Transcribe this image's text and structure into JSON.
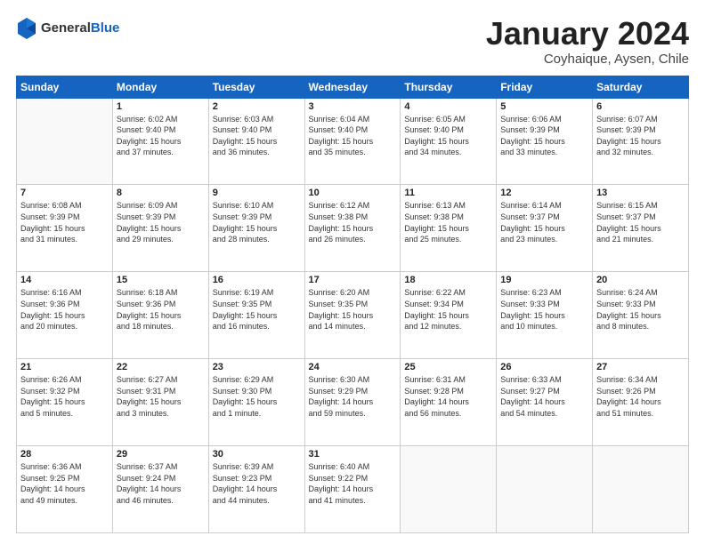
{
  "logo": {
    "general": "General",
    "blue": "Blue"
  },
  "header": {
    "title": "January 2024",
    "location": "Coyhaique, Aysen, Chile"
  },
  "weekdays": [
    "Sunday",
    "Monday",
    "Tuesday",
    "Wednesday",
    "Thursday",
    "Friday",
    "Saturday"
  ],
  "weeks": [
    [
      {
        "day": "",
        "info": ""
      },
      {
        "day": "1",
        "info": "Sunrise: 6:02 AM\nSunset: 9:40 PM\nDaylight: 15 hours\nand 37 minutes."
      },
      {
        "day": "2",
        "info": "Sunrise: 6:03 AM\nSunset: 9:40 PM\nDaylight: 15 hours\nand 36 minutes."
      },
      {
        "day": "3",
        "info": "Sunrise: 6:04 AM\nSunset: 9:40 PM\nDaylight: 15 hours\nand 35 minutes."
      },
      {
        "day": "4",
        "info": "Sunrise: 6:05 AM\nSunset: 9:40 PM\nDaylight: 15 hours\nand 34 minutes."
      },
      {
        "day": "5",
        "info": "Sunrise: 6:06 AM\nSunset: 9:39 PM\nDaylight: 15 hours\nand 33 minutes."
      },
      {
        "day": "6",
        "info": "Sunrise: 6:07 AM\nSunset: 9:39 PM\nDaylight: 15 hours\nand 32 minutes."
      }
    ],
    [
      {
        "day": "7",
        "info": "Sunrise: 6:08 AM\nSunset: 9:39 PM\nDaylight: 15 hours\nand 31 minutes."
      },
      {
        "day": "8",
        "info": "Sunrise: 6:09 AM\nSunset: 9:39 PM\nDaylight: 15 hours\nand 29 minutes."
      },
      {
        "day": "9",
        "info": "Sunrise: 6:10 AM\nSunset: 9:39 PM\nDaylight: 15 hours\nand 28 minutes."
      },
      {
        "day": "10",
        "info": "Sunrise: 6:12 AM\nSunset: 9:38 PM\nDaylight: 15 hours\nand 26 minutes."
      },
      {
        "day": "11",
        "info": "Sunrise: 6:13 AM\nSunset: 9:38 PM\nDaylight: 15 hours\nand 25 minutes."
      },
      {
        "day": "12",
        "info": "Sunrise: 6:14 AM\nSunset: 9:37 PM\nDaylight: 15 hours\nand 23 minutes."
      },
      {
        "day": "13",
        "info": "Sunrise: 6:15 AM\nSunset: 9:37 PM\nDaylight: 15 hours\nand 21 minutes."
      }
    ],
    [
      {
        "day": "14",
        "info": "Sunrise: 6:16 AM\nSunset: 9:36 PM\nDaylight: 15 hours\nand 20 minutes."
      },
      {
        "day": "15",
        "info": "Sunrise: 6:18 AM\nSunset: 9:36 PM\nDaylight: 15 hours\nand 18 minutes."
      },
      {
        "day": "16",
        "info": "Sunrise: 6:19 AM\nSunset: 9:35 PM\nDaylight: 15 hours\nand 16 minutes."
      },
      {
        "day": "17",
        "info": "Sunrise: 6:20 AM\nSunset: 9:35 PM\nDaylight: 15 hours\nand 14 minutes."
      },
      {
        "day": "18",
        "info": "Sunrise: 6:22 AM\nSunset: 9:34 PM\nDaylight: 15 hours\nand 12 minutes."
      },
      {
        "day": "19",
        "info": "Sunrise: 6:23 AM\nSunset: 9:33 PM\nDaylight: 15 hours\nand 10 minutes."
      },
      {
        "day": "20",
        "info": "Sunrise: 6:24 AM\nSunset: 9:33 PM\nDaylight: 15 hours\nand 8 minutes."
      }
    ],
    [
      {
        "day": "21",
        "info": "Sunrise: 6:26 AM\nSunset: 9:32 PM\nDaylight: 15 hours\nand 5 minutes."
      },
      {
        "day": "22",
        "info": "Sunrise: 6:27 AM\nSunset: 9:31 PM\nDaylight: 15 hours\nand 3 minutes."
      },
      {
        "day": "23",
        "info": "Sunrise: 6:29 AM\nSunset: 9:30 PM\nDaylight: 15 hours\nand 1 minute."
      },
      {
        "day": "24",
        "info": "Sunrise: 6:30 AM\nSunset: 9:29 PM\nDaylight: 14 hours\nand 59 minutes."
      },
      {
        "day": "25",
        "info": "Sunrise: 6:31 AM\nSunset: 9:28 PM\nDaylight: 14 hours\nand 56 minutes."
      },
      {
        "day": "26",
        "info": "Sunrise: 6:33 AM\nSunset: 9:27 PM\nDaylight: 14 hours\nand 54 minutes."
      },
      {
        "day": "27",
        "info": "Sunrise: 6:34 AM\nSunset: 9:26 PM\nDaylight: 14 hours\nand 51 minutes."
      }
    ],
    [
      {
        "day": "28",
        "info": "Sunrise: 6:36 AM\nSunset: 9:25 PM\nDaylight: 14 hours\nand 49 minutes."
      },
      {
        "day": "29",
        "info": "Sunrise: 6:37 AM\nSunset: 9:24 PM\nDaylight: 14 hours\nand 46 minutes."
      },
      {
        "day": "30",
        "info": "Sunrise: 6:39 AM\nSunset: 9:23 PM\nDaylight: 14 hours\nand 44 minutes."
      },
      {
        "day": "31",
        "info": "Sunrise: 6:40 AM\nSunset: 9:22 PM\nDaylight: 14 hours\nand 41 minutes."
      },
      {
        "day": "",
        "info": ""
      },
      {
        "day": "",
        "info": ""
      },
      {
        "day": "",
        "info": ""
      }
    ]
  ]
}
